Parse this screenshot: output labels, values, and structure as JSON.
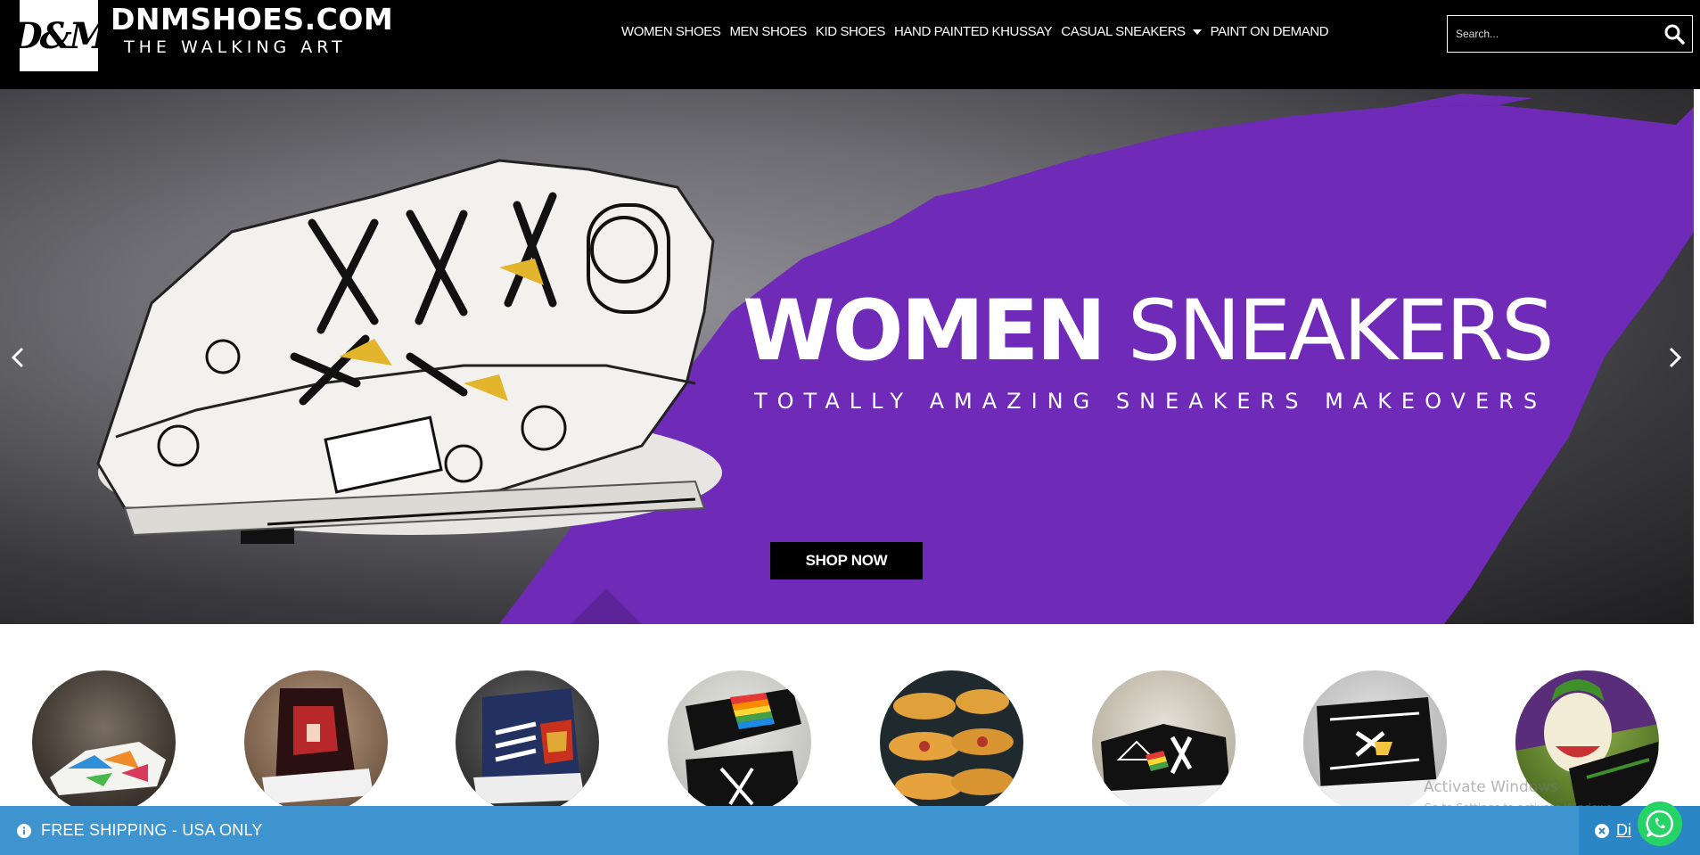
{
  "brand": {
    "mark": "D&M",
    "name": "DNMSHOES.COM",
    "tagline": "THE WALKING ART"
  },
  "nav": {
    "items": [
      {
        "label": "WOMEN SHOES"
      },
      {
        "label": "MEN SHOES"
      },
      {
        "label": "KID SHOES"
      },
      {
        "label": "HAND PAINTED KHUSSAY"
      },
      {
        "label": "CASUAL SNEAKERS"
      },
      {
        "label": "PAINT ON DEMAND"
      }
    ]
  },
  "search": {
    "placeholder": "Search...",
    "icon": "search-icon"
  },
  "hero": {
    "title_bold": "WOMEN",
    "title_light": "SNEAKERS",
    "subtitle": "TOTALLY AMAZING SNEAKERS MAKEOVERS",
    "button_label": "SHOP NOW",
    "accent_color": "#6f2ab8",
    "prev_icon": "chevron-left-icon",
    "next_icon": "chevron-right-icon"
  },
  "categories": [
    {
      "name": "graffiti-sneakers"
    },
    {
      "name": "anime-sneakers"
    },
    {
      "name": "ironman-sneakers"
    },
    {
      "name": "rainbow-slip-ons"
    },
    {
      "name": "khussay"
    },
    {
      "name": "pink-floyd-sneakers"
    },
    {
      "name": "hollywood-sneakers"
    },
    {
      "name": "joker-sneakers"
    }
  ],
  "watermark": {
    "title": "Activate Windows",
    "subtitle": "Go to Settings to activate Windows."
  },
  "notice_bar": {
    "text": "FREE SHIPPING - USA ONLY",
    "dismiss_label": "Di",
    "color": "#3d94cf"
  },
  "whatsapp": {
    "icon": "whatsapp-icon",
    "color": "#25d366"
  }
}
